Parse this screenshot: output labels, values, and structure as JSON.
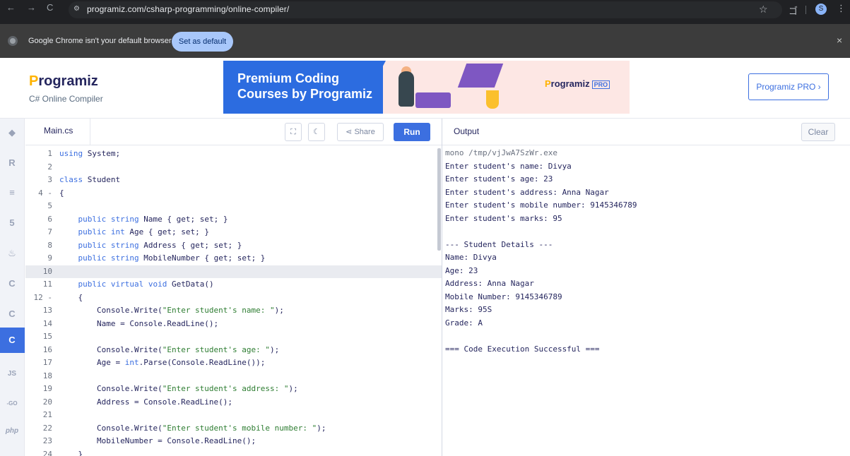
{
  "browser": {
    "back": "←",
    "forward": "→",
    "reload": "C",
    "url": "programiz.com/csharp-programming/online-compiler/",
    "star": "☆",
    "extensions": "ゴ",
    "profile": "S",
    "menu": "⋮"
  },
  "infobar": {
    "message": "Google Chrome isn't your default browser",
    "set_default": "Set as default",
    "close": "×"
  },
  "header": {
    "logo": "rogramiz",
    "logo_p": "P",
    "subtitle": "C# Online Compiler",
    "banner_title_line1": "Premium Coding",
    "banner_title_line2": "Courses by Programiz",
    "banner_brand": "rogramiz",
    "banner_brand_p": "P",
    "banner_pro": "PRO",
    "pro_button": "Programiz PRO ›"
  },
  "rail": {
    "items": [
      "◆",
      "R",
      "≡",
      "5",
      "♨",
      "C",
      "C",
      "C",
      "JS",
      "-GO",
      "php"
    ]
  },
  "editor": {
    "file_name": "Main.cs",
    "share_label": "Share",
    "run_label": "Run",
    "lines": [
      {
        "n": "1",
        "code": "using System;"
      },
      {
        "n": "2",
        "code": ""
      },
      {
        "n": "3",
        "code": "class Student"
      },
      {
        "n": "4 -",
        "code": "{"
      },
      {
        "n": "5",
        "code": ""
      },
      {
        "n": "6",
        "code": "    public string Name { get; set; }"
      },
      {
        "n": "7",
        "code": "    public int Age { get; set; }"
      },
      {
        "n": "8",
        "code": "    public string Address { get; set; }"
      },
      {
        "n": "9",
        "code": "    public string MobileNumber { get; set; }"
      },
      {
        "n": "10",
        "code": ""
      },
      {
        "n": "11",
        "code": "    public virtual void GetData()"
      },
      {
        "n": "12 -",
        "code": "    {"
      },
      {
        "n": "13",
        "code": "        Console.Write(\"Enter student's name: \");"
      },
      {
        "n": "14",
        "code": "        Name = Console.ReadLine();"
      },
      {
        "n": "15",
        "code": ""
      },
      {
        "n": "16",
        "code": "        Console.Write(\"Enter student's age: \");"
      },
      {
        "n": "17",
        "code": "        Age = int.Parse(Console.ReadLine());"
      },
      {
        "n": "18",
        "code": ""
      },
      {
        "n": "19",
        "code": "        Console.Write(\"Enter student's address: \");"
      },
      {
        "n": "20",
        "code": "        Address = Console.ReadLine();"
      },
      {
        "n": "21",
        "code": ""
      },
      {
        "n": "22",
        "code": "        Console.Write(\"Enter student's mobile number: \");"
      },
      {
        "n": "23",
        "code": "        MobileNumber = Console.ReadLine();"
      },
      {
        "n": "24",
        "code": "    }"
      }
    ]
  },
  "output": {
    "title": "Output",
    "clear_label": "Clear",
    "lines": [
      "mono /tmp/vjJwA7SzWr.exe",
      "Enter student's name: Divya",
      "Enter student's age: 23",
      "Enter student's address: Anna Nagar",
      "Enter student's mobile number: 9145346789",
      "Enter student's marks: 95",
      "",
      "--- Student Details ---",
      "Name: Divya",
      "Age: 23",
      "Address: Anna Nagar",
      "Mobile Number: 9145346789",
      "Marks: 95S",
      "Grade: A",
      "",
      "=== Code Execution Successful ==="
    ]
  }
}
